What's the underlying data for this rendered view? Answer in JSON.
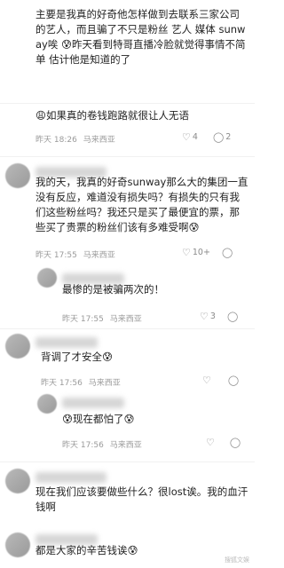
{
  "comments": [
    {
      "text": "主要是我真的好奇他怎样做到去联系三家公司的艺人，而且骗了不只是粉丝 艺人 媒体 sunway唉 😰昨天看到特哥直播冷脸就觉得事情不简单 估计他是知道的了"
    },
    {
      "text": "😩如果真的卷钱跑路就很让人无语",
      "time": "昨天 18:26",
      "location": "马来西亚",
      "likes": "4",
      "replies_icon": "reply-icon"
    },
    {
      "text": "我的天，我真的好奇sunway那么大的集团一直没有反应，难道没有损失吗？有损失的只有我们这些粉丝吗？我还只是买了最便宜的票，那些买了贵票的粉丝们该有多难受啊😰",
      "time": "昨天 17:55",
      "location": "马来西亚",
      "likes": "10+"
    },
    {
      "text": "最惨的是被骗两次的！",
      "time": "昨天 17:55",
      "location": "马来西亚",
      "likes": "3"
    },
    {
      "text": "背调了才安全😰",
      "time": "昨天 17:56",
      "location": "马来西亚"
    },
    {
      "text": "😰现在都怕了😰",
      "time": "昨天 17:56",
      "location": "马来西亚"
    },
    {
      "text": "现在我们应该要做些什么？很lost诶。我的血汗钱啊"
    },
    {
      "text": "都是大家的辛苦钱诶😰"
    }
  ],
  "watermark": "搜狐文娱"
}
